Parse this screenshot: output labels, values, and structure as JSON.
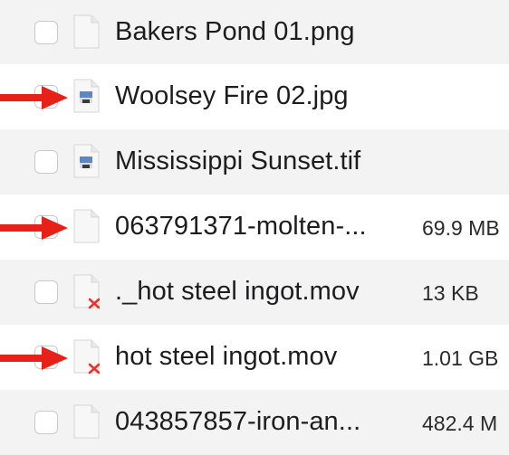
{
  "files": [
    {
      "name": "Bakers Pond 01.png",
      "size": "",
      "icon": "blank-document-icon",
      "annotated": false
    },
    {
      "name": "Woolsey Fire 02.jpg",
      "size": "",
      "icon": "image-preview-icon",
      "annotated": true
    },
    {
      "name": "Mississippi Sunset.tif",
      "size": "",
      "icon": "image-preview-icon",
      "annotated": false
    },
    {
      "name": "063791371-molten-...",
      "size": "69.9 MB",
      "icon": "blank-document-icon",
      "annotated": true
    },
    {
      "name": "._hot steel ingot.mov",
      "size": "13 KB",
      "icon": "error-document-icon",
      "annotated": false
    },
    {
      "name": "hot steel ingot.mov",
      "size": "1.01 GB",
      "icon": "error-document-icon",
      "annotated": true
    },
    {
      "name": "043857857-iron-an...",
      "size": "482.4 M",
      "icon": "blank-document-icon",
      "annotated": false
    }
  ],
  "colors": {
    "arrow": "#e8201a",
    "row_alt": "#f3f3f4",
    "error_x": "#e8332a"
  }
}
